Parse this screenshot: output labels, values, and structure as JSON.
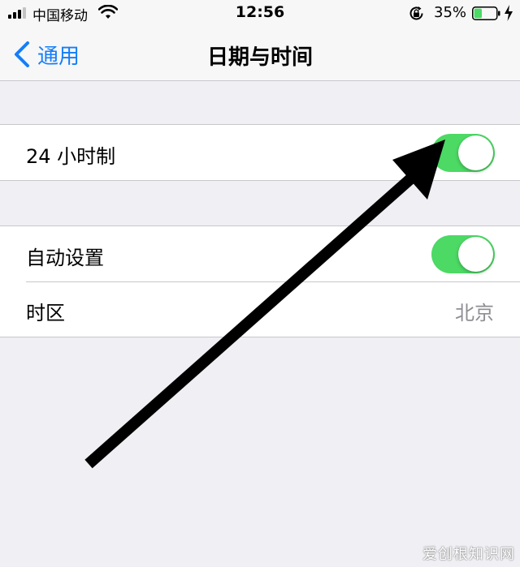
{
  "status_bar": {
    "carrier": "中国移动",
    "time": "12:56",
    "battery_percent": "35%",
    "battery_level": 0.35,
    "signal_bars_filled": 3,
    "signal_bars_total": 4,
    "icons": [
      "signal-icon",
      "wifi-icon",
      "rotation-lock-icon",
      "battery-icon",
      "charging-icon"
    ]
  },
  "nav": {
    "back_label": "通用",
    "title": "日期与时间"
  },
  "settings": {
    "hour24": {
      "label": "24 小时制",
      "enabled": true
    },
    "auto_set": {
      "label": "自动设置",
      "enabled": true
    },
    "time_zone": {
      "label": "时区",
      "value": "北京"
    }
  },
  "colors": {
    "accent": "#147efb",
    "toggle_on": "#4cd964",
    "background": "#efeff4",
    "secondary_text": "#8e8e93"
  },
  "watermark": "爱创根知识网"
}
